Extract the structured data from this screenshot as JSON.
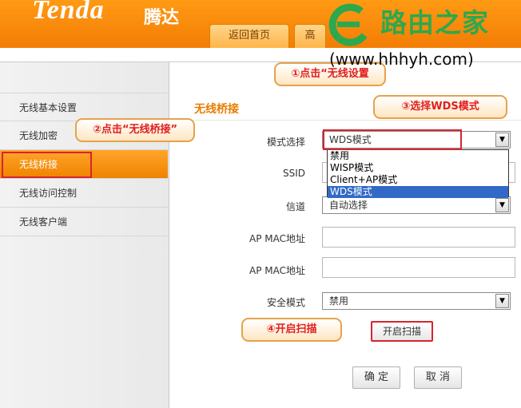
{
  "header": {
    "logo": "Tenda",
    "logo_cn": "腾达",
    "tabs": [
      {
        "label": "返回首页"
      },
      {
        "label": "高"
      }
    ]
  },
  "sidebar": {
    "items": [
      {
        "label": "无线基本设置"
      },
      {
        "label": "无线加密"
      },
      {
        "label": "无线桥接"
      },
      {
        "label": "无线访问控制"
      },
      {
        "label": "无线客户端"
      }
    ]
  },
  "main": {
    "section_title": "无线桥接",
    "fields": {
      "mode": {
        "label": "模式选择",
        "value": "WDS模式"
      },
      "ssid": {
        "label": "SSID"
      },
      "channel": {
        "label": "信道",
        "value": "自动选择"
      },
      "ap_mac1": {
        "label": "AP MAC地址",
        "value": ""
      },
      "ap_mac2": {
        "label": "AP MAC地址",
        "value": ""
      },
      "security": {
        "label": "安全模式",
        "value": "禁用"
      }
    },
    "dropdown_options": [
      "禁用",
      "WISP模式",
      "Client+AP模式",
      "WDS模式"
    ],
    "scan_button": "开启扫描",
    "ok_button": "确 定",
    "cancel_button": "取 消"
  },
  "callouts": {
    "step1": "①点击“无线设置",
    "step2": "②点击“无线桥接”",
    "step3": "③选择WDS模式",
    "step4": "④开启扫描"
  },
  "watermark": {
    "text": "路由之家",
    "url": "(www.hhhyh.com)"
  },
  "colors": {
    "accent": "#f08300",
    "callout_text": "#e02020",
    "highlight": "#3169c6",
    "watermark": "#2ea84d"
  }
}
